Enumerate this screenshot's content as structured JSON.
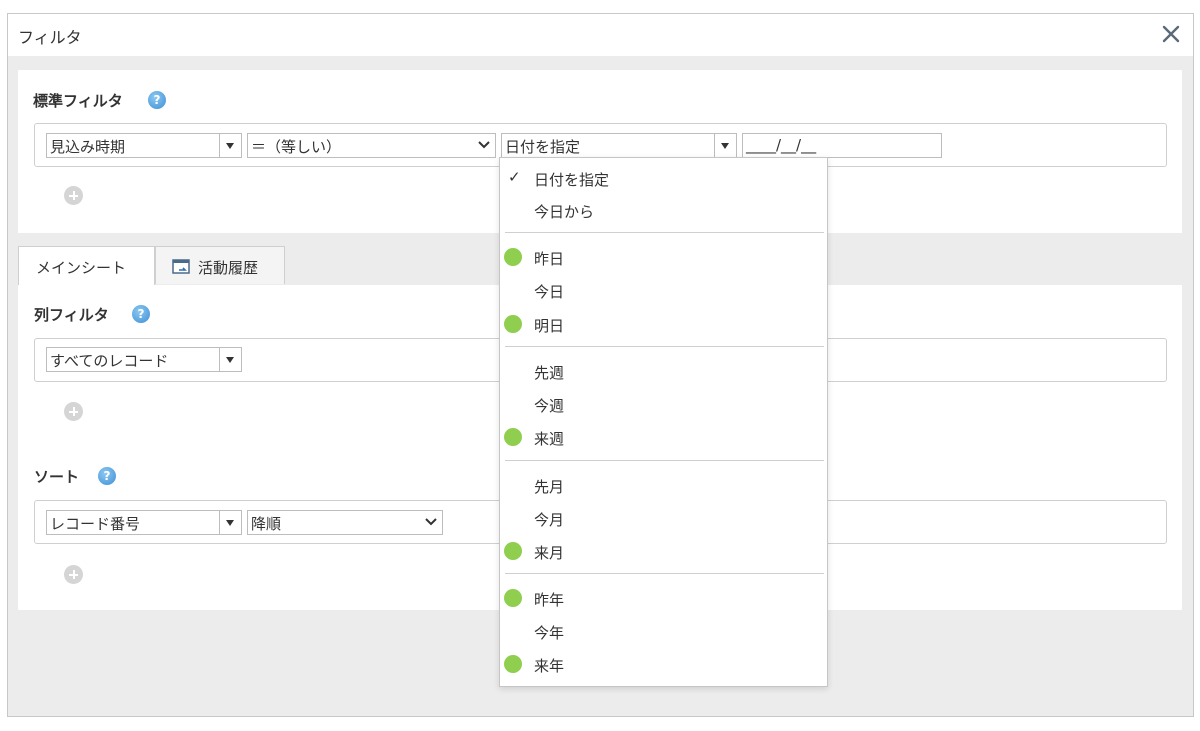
{
  "dialog": {
    "title": "フィルタ",
    "close_icon": "close-icon"
  },
  "standard_filter": {
    "label": "標準フィルタ",
    "help": "?",
    "field_select": "見込み時期",
    "operator_select": "＝（等しい）",
    "date_mode_select": "日付を指定",
    "date_input": "____/__/__"
  },
  "tabs": [
    {
      "label": "メインシート"
    },
    {
      "label": "活動履歴",
      "icon": "activity-history-icon"
    }
  ],
  "column_filter": {
    "label": "列フィルタ",
    "help": "?",
    "select": "すべてのレコード"
  },
  "sort": {
    "label": "ソート",
    "help": "?",
    "field_select": "レコード番号",
    "order_select": "降順"
  },
  "date_menu": {
    "check_mark": "✓",
    "items": [
      {
        "label": "日付を指定",
        "checked": true,
        "dot": false
      },
      {
        "label": "今日から",
        "dot": false
      },
      {
        "label": "昨日",
        "dot": true
      },
      {
        "label": "今日",
        "dot": false
      },
      {
        "label": "明日",
        "dot": true
      },
      {
        "label": "先週",
        "dot": false
      },
      {
        "label": "今週",
        "dot": false
      },
      {
        "label": "来週",
        "dot": true
      },
      {
        "label": "先月",
        "dot": false
      },
      {
        "label": "今月",
        "dot": false
      },
      {
        "label": "来月",
        "dot": true
      },
      {
        "label": "昨年",
        "dot": true
      },
      {
        "label": "今年",
        "dot": false
      },
      {
        "label": "来年",
        "dot": true
      }
    ]
  },
  "colors": {
    "dot_green": "#8fce4e",
    "help_blue": "#3d8fd6",
    "background": "#ececec"
  }
}
